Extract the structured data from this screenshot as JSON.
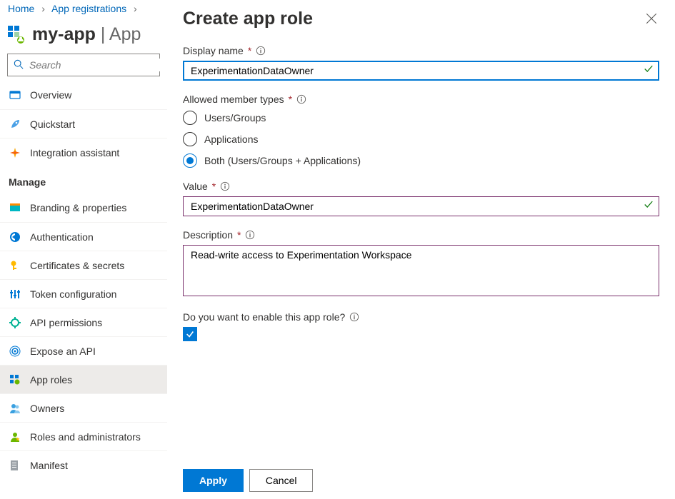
{
  "breadcrumb": {
    "home": "Home",
    "section": "App registrations"
  },
  "page": {
    "app_name": "my-app",
    "subtitle_fragment": "| App"
  },
  "search": {
    "placeholder": "Search"
  },
  "nav": {
    "top": [
      {
        "label": "Overview"
      },
      {
        "label": "Quickstart"
      },
      {
        "label": "Integration assistant"
      }
    ],
    "manage_heading": "Manage",
    "manage": [
      {
        "label": "Branding & properties"
      },
      {
        "label": "Authentication"
      },
      {
        "label": "Certificates & secrets"
      },
      {
        "label": "Token configuration"
      },
      {
        "label": "API permissions"
      },
      {
        "label": "Expose an API"
      },
      {
        "label": "App roles",
        "selected": true
      },
      {
        "label": "Owners"
      },
      {
        "label": "Roles and administrators"
      },
      {
        "label": "Manifest"
      }
    ]
  },
  "panel": {
    "title": "Create app role",
    "display_name": {
      "label": "Display name",
      "value": "ExperimentationDataOwner"
    },
    "member_types": {
      "label": "Allowed member types",
      "options": [
        {
          "label": "Users/Groups"
        },
        {
          "label": "Applications"
        },
        {
          "label": "Both (Users/Groups + Applications)",
          "selected": true
        }
      ]
    },
    "value": {
      "label": "Value",
      "value": "ExperimentationDataOwner"
    },
    "description": {
      "label": "Description",
      "value": "Read-write access to Experimentation Workspace"
    },
    "enable": {
      "label": "Do you want to enable this app role?",
      "checked": true
    },
    "buttons": {
      "apply": "Apply",
      "cancel": "Cancel"
    }
  }
}
